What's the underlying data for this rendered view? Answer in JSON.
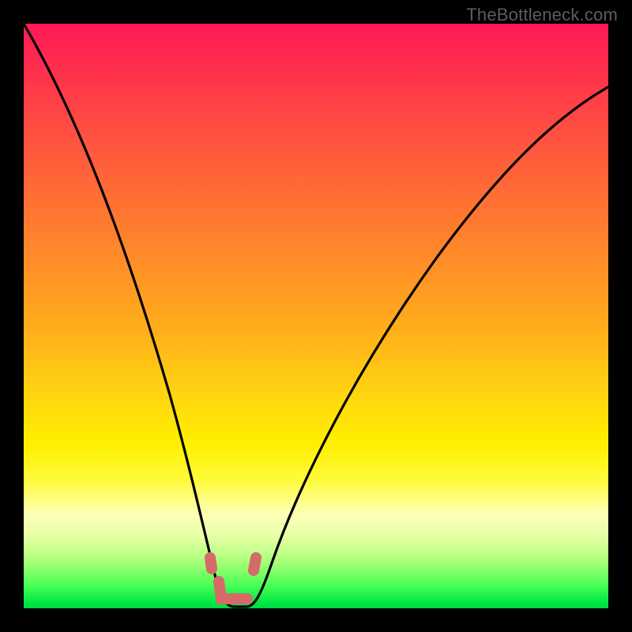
{
  "watermark": "TheBottleneck.com",
  "colors": {
    "frame": "#000000",
    "curve_stroke": "#000000",
    "marker_fill": "#d46a6a",
    "gradient_top": "#ff1957",
    "gradient_bottom": "#00d840"
  },
  "chart_data": {
    "type": "line",
    "title": "",
    "xlabel": "",
    "ylabel": "",
    "xlim": [
      0,
      100
    ],
    "ylim": [
      0,
      100
    ],
    "grid": false,
    "legend": false,
    "annotations": [
      "TheBottleneck.com"
    ],
    "series": [
      {
        "name": "bottleneck-curve",
        "x": [
          0,
          5,
          10,
          15,
          20,
          25,
          28,
          30,
          32,
          34,
          36,
          38,
          40,
          45,
          50,
          55,
          60,
          65,
          70,
          75,
          80,
          85,
          90,
          95,
          100
        ],
        "values": [
          100,
          86,
          72,
          58,
          45,
          30,
          18,
          10,
          4,
          1,
          0,
          0,
          3,
          12,
          22,
          31,
          39,
          46,
          53,
          59,
          64,
          69,
          73,
          77,
          80
        ]
      }
    ],
    "markers": [
      {
        "name": "left-dot",
        "x": 30.5,
        "y": 9
      },
      {
        "name": "right-dot",
        "x": 38.5,
        "y": 8
      },
      {
        "name": "valley-segment",
        "x_from": 31,
        "x_to": 38,
        "y": 2
      }
    ]
  }
}
